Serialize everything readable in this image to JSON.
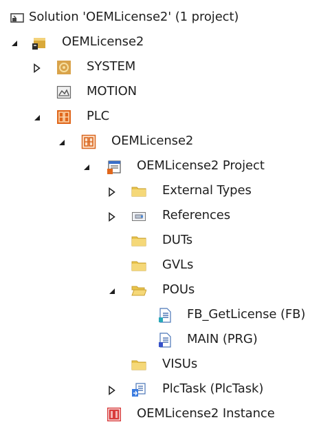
{
  "solution_explorer": {
    "rows": [
      {
        "label": "Solution 'OEMLicense2' (1 project)",
        "icon": "solution-icon",
        "expander": "none"
      },
      {
        "label": "OEMLicense2",
        "icon": "twincat-project-icon",
        "expander": "expanded"
      },
      {
        "label": "SYSTEM",
        "icon": "system-icon",
        "expander": "collapsed"
      },
      {
        "label": "MOTION",
        "icon": "motion-icon",
        "expander": "none"
      },
      {
        "label": "PLC",
        "icon": "plc-icon",
        "expander": "expanded"
      },
      {
        "label": "OEMLicense2",
        "icon": "plc-project-icon",
        "expander": "expanded"
      },
      {
        "label": "OEMLicense2 Project",
        "icon": "plc-project-file-icon",
        "expander": "expanded"
      },
      {
        "label": "External Types",
        "icon": "folder-icon",
        "expander": "collapsed"
      },
      {
        "label": "References",
        "icon": "references-icon",
        "expander": "collapsed"
      },
      {
        "label": "DUTs",
        "icon": "folder-icon",
        "expander": "none"
      },
      {
        "label": "GVLs",
        "icon": "folder-icon",
        "expander": "none"
      },
      {
        "label": "POUs",
        "icon": "folder-open-icon",
        "expander": "expanded"
      },
      {
        "label": "FB_GetLicense (FB)",
        "icon": "function-block-icon",
        "expander": "none"
      },
      {
        "label": "MAIN (PRG)",
        "icon": "program-icon",
        "expander": "none"
      },
      {
        "label": "VISUs",
        "icon": "folder-icon",
        "expander": "none"
      },
      {
        "label": "PlcTask (PlcTask)",
        "icon": "task-icon",
        "expander": "collapsed"
      },
      {
        "label": "OEMLicense2 Instance",
        "icon": "instance-icon",
        "expander": "none"
      }
    ]
  },
  "colors": {
    "text": "#1e1e1e",
    "folder": "#e8c34b",
    "plc": "#e0671c",
    "expander": "#1e1e1e"
  }
}
